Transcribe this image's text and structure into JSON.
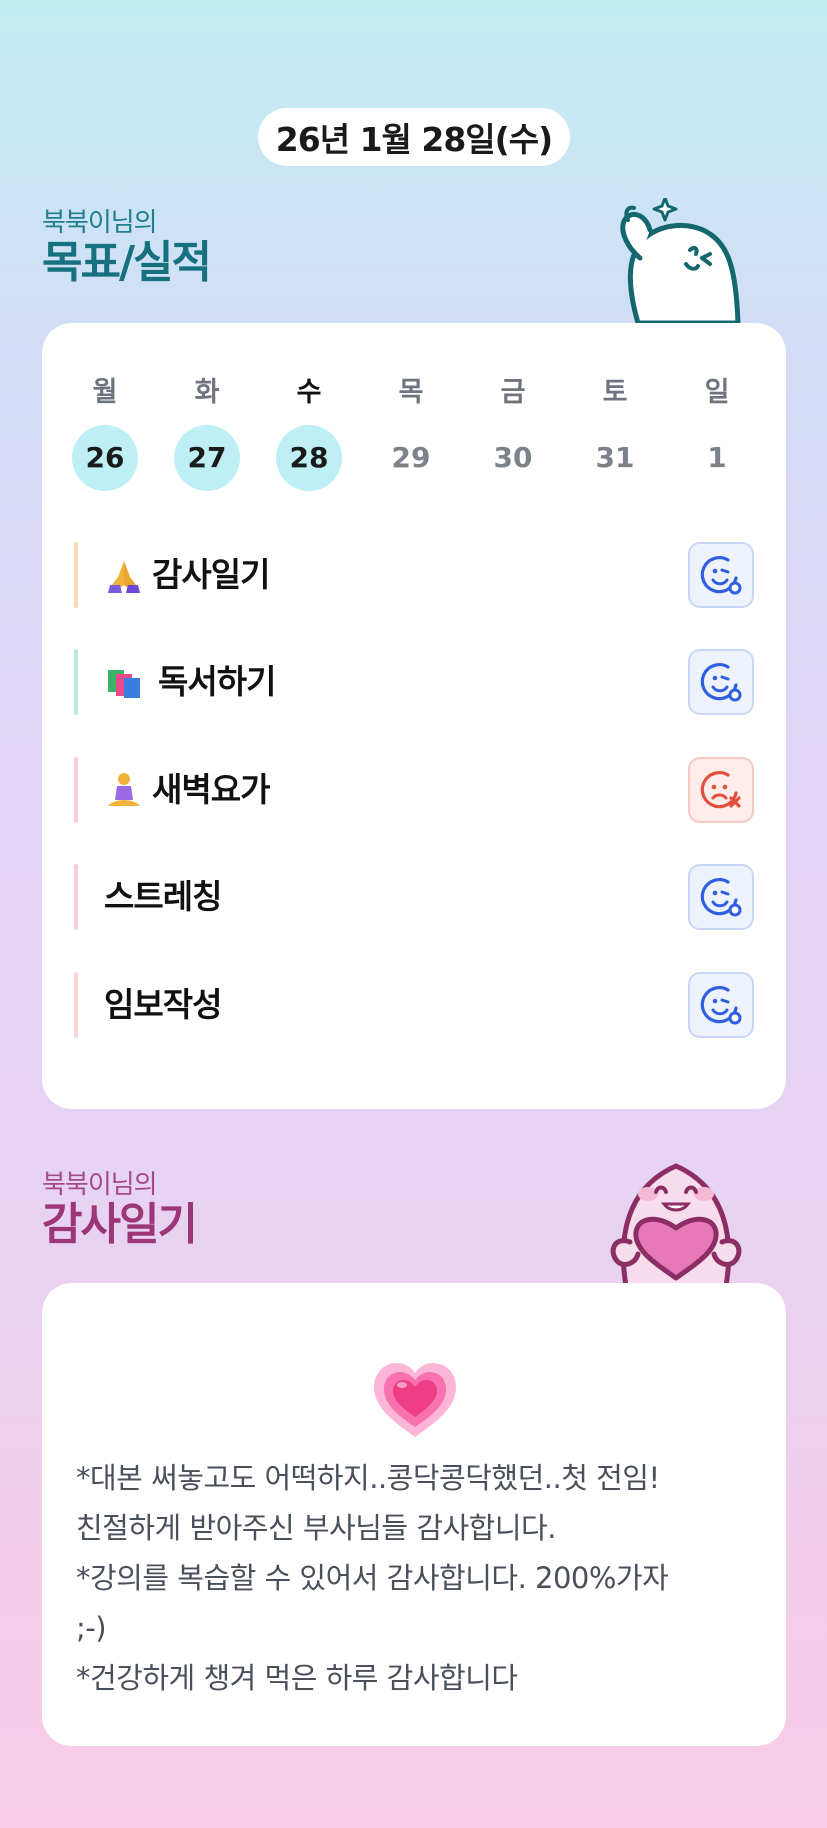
{
  "date_label": "26년 1월 28일(수)",
  "goal_section": {
    "subtitle": "북북이님의",
    "title": "목표/실적"
  },
  "week": [
    {
      "name": "월",
      "num": "26",
      "done": true,
      "today": false
    },
    {
      "name": "화",
      "num": "27",
      "done": true,
      "today": false
    },
    {
      "name": "수",
      "num": "28",
      "done": true,
      "today": true
    },
    {
      "name": "목",
      "num": "29",
      "done": false,
      "today": false
    },
    {
      "name": "금",
      "num": "30",
      "done": false,
      "today": false
    },
    {
      "name": "토",
      "num": "31",
      "done": false,
      "today": false
    },
    {
      "name": "일",
      "num": "1",
      "done": false,
      "today": false
    }
  ],
  "goals": [
    {
      "label": "감사일기",
      "emoji": "folded-hands-icon",
      "bar_color": "#fbd9b4",
      "status": "success"
    },
    {
      "label": "독서하기",
      "emoji": "books-icon",
      "bar_color": "#b9ecd9",
      "status": "success"
    },
    {
      "label": "새벽요가",
      "emoji": "yoga-icon",
      "bar_color": "#f8cbe3",
      "status": "fail"
    },
    {
      "label": "스트레칭",
      "emoji": "",
      "bar_color": "#f8cbe3",
      "status": "success"
    },
    {
      "label": "임보작성",
      "emoji": "",
      "bar_color": "#fbd3d3",
      "status": "success"
    }
  ],
  "gratitude_section": {
    "subtitle": "북북이님의",
    "title": "감사일기"
  },
  "gratitude_lines": [
    "*대본 써놓고도 어떡하지..콩닥콩닥했던..첫 전임!",
    "친절하게 받아주신 부사님들 감사합니다.",
    "*강의를 복습할 수 있어서 감사합니다. 200%가자",
    ";-)",
    "*건강하게 챙겨 먹은 하루 감사합니다"
  ],
  "colors": {
    "success": "#2f5fe0",
    "fail": "#e2503d",
    "done_day": "#bdeff4"
  }
}
